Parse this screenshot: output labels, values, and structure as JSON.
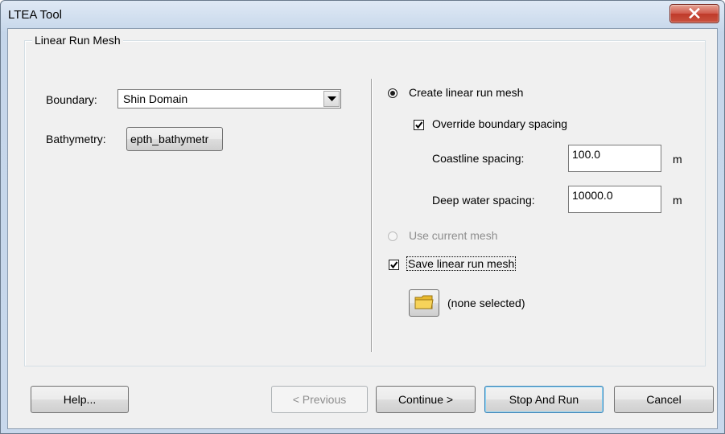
{
  "window": {
    "title": "LTEA Tool",
    "close_icon": "close-x-icon",
    "colors": {
      "title_bar": "#c5d6ea",
      "client": "#f0f0f0",
      "close_button": "#c9523f",
      "disabled_text": "#8d8d8d"
    }
  },
  "group": {
    "title": "Linear Run Mesh"
  },
  "boundary": {
    "label": "Boundary:",
    "selected": "Shin Domain"
  },
  "bathymetry": {
    "label": "Bathymetry:",
    "button_label": "epth_bathymetr"
  },
  "options": {
    "create_mesh": {
      "label": "Create linear run mesh",
      "selected": true
    },
    "override_spacing": {
      "label": "Override boundary spacing",
      "checked": true
    },
    "coastline": {
      "label": "Coastline spacing:",
      "value": "100.0",
      "unit": "m"
    },
    "deep_water": {
      "label": "Deep water spacing:",
      "value": "10000.0",
      "unit": "m"
    },
    "use_current": {
      "label": "Use current mesh",
      "selected": false,
      "enabled": false
    },
    "save_mesh": {
      "label": "Save linear run mesh",
      "checked": true
    },
    "file": {
      "icon": "folder-icon",
      "selection": "(none selected)"
    }
  },
  "buttons": {
    "help": "Help...",
    "previous": "< Previous",
    "continue": "Continue >",
    "stop_and_run": "Stop And Run",
    "cancel": "Cancel"
  }
}
